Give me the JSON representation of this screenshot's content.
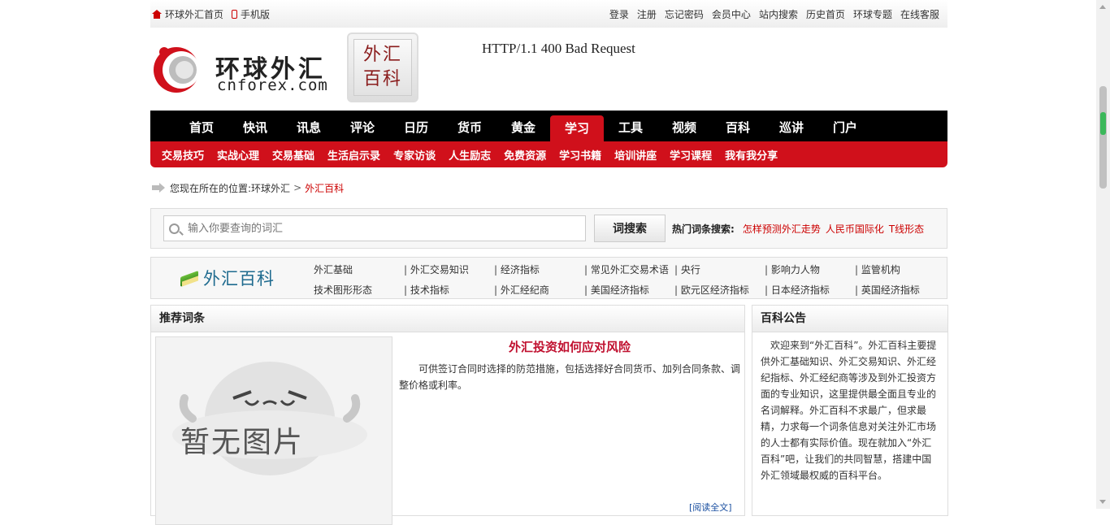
{
  "topbar": {
    "home_label": "环球外汇首页",
    "mobile_label": "手机版",
    "links": [
      "登录",
      "注册",
      "忘记密码",
      "会员中心",
      "站内搜索",
      "历史首页",
      "环球专题",
      "在线客服"
    ]
  },
  "header": {
    "logo_cn": "环球外汇",
    "logo_en": "cnforex.com",
    "badge_line1": "外汇",
    "badge_line2": "百科",
    "error_text": "HTTP/1.1 400 Bad Request"
  },
  "mainnav": {
    "items": [
      "首页",
      "快讯",
      "讯息",
      "评论",
      "日历",
      "货币",
      "黄金",
      "学习",
      "工具",
      "视频",
      "百科",
      "巡讲",
      "门户"
    ],
    "active": "学习"
  },
  "subnav": {
    "items": [
      "交易技巧",
      "实战心理",
      "交易基础",
      "生活启示录",
      "专家访谈",
      "人生励志",
      "免费资源",
      "学习书籍",
      "培训讲座",
      "学习课程",
      "我有我分享"
    ]
  },
  "breadcrumb": {
    "prefix": "您现在所在的位置:",
    "root": "环球外汇",
    "sep": ">",
    "current": "外汇百科"
  },
  "search": {
    "placeholder": "输入你要查询的词汇",
    "button_label": "词搜索",
    "hot_label": "热门词条搜索:",
    "hot_links": [
      "怎样预测外汇走势",
      "人民币国际化",
      "T线形态"
    ]
  },
  "categories": {
    "logo_text": "外汇百科",
    "items": [
      "外汇基础",
      "外汇交易知识",
      "经济指标",
      "常见外汇交易术语",
      "央行",
      "影响力人物",
      "监管机构",
      "技术图形形态",
      "技术指标",
      "外汇经纪商",
      "美国经济指标",
      "欧元区经济指标",
      "日本经济指标",
      "英国经济指标"
    ]
  },
  "recommend": {
    "title": "推荐词条",
    "noimage_text": "暂无图片",
    "article_title": "外汇投资如何应对风险",
    "article_desc": "可供签订合同时选择的防范措施，包括选择好合同货币、加列合同条款、调整价格或利率。",
    "read_more": "[阅读全文]"
  },
  "notice": {
    "title": "百科公告",
    "text": "欢迎来到“外汇百科”。外汇百科主要提供外汇基础知识、外汇交易知识、外汇经纪指标、外汇经纪商等涉及到外汇投资方面的专业知识，这里提供最全面且专业的名词解释。外汇百科不求最广，但求最精，力求每一个词条信息对关注外汇市场的人士都有实际价值。现在就加入“外汇百科”吧，让我们的共同智慧，搭建中国外汇领域最权威的百科平台。"
  },
  "colors": {
    "brand_red": "#d0101b",
    "nav_black": "#000000",
    "link_red": "#cc0000"
  }
}
